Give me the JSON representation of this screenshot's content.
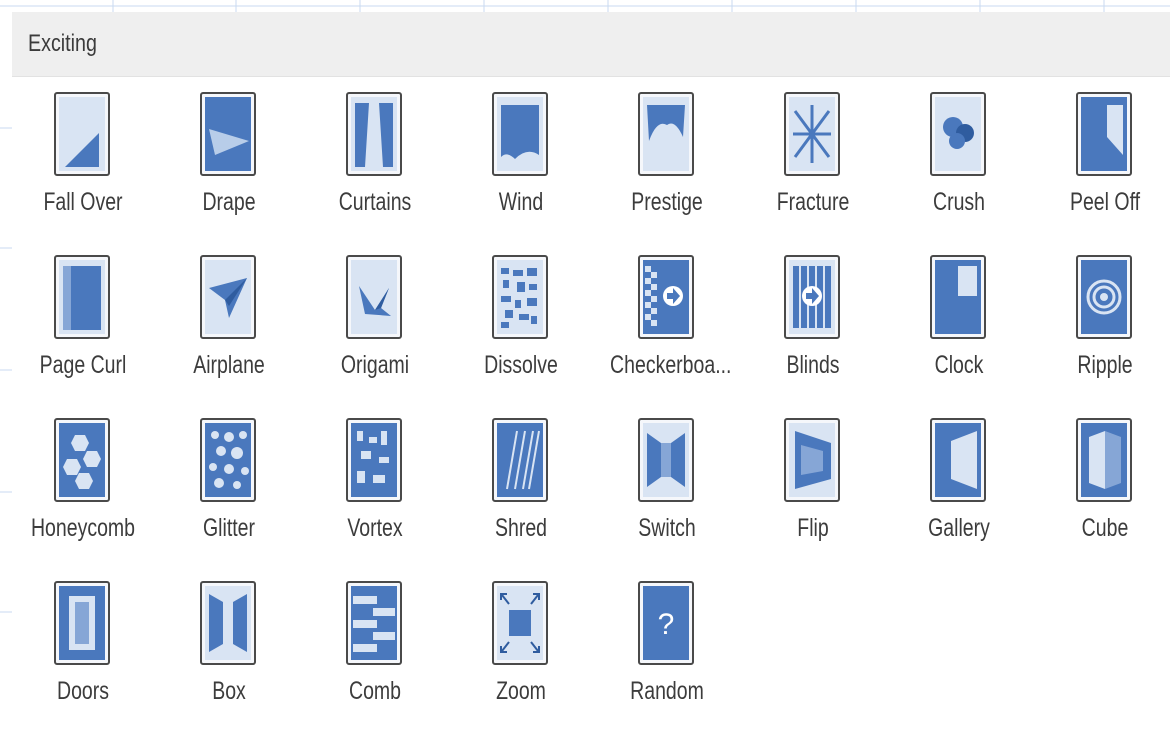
{
  "section": {
    "title": "Exciting"
  },
  "colors": {
    "accent": "#4a78bd",
    "light": "#d9e4f3",
    "header_bg": "#efefef",
    "text": "#3c3c3c"
  },
  "transitions": [
    {
      "label": "Fall Over",
      "icon": "fall-over-icon"
    },
    {
      "label": "Drape",
      "icon": "drape-icon"
    },
    {
      "label": "Curtains",
      "icon": "curtains-icon"
    },
    {
      "label": "Wind",
      "icon": "wind-icon"
    },
    {
      "label": "Prestige",
      "icon": "prestige-icon"
    },
    {
      "label": "Fracture",
      "icon": "fracture-icon"
    },
    {
      "label": "Crush",
      "icon": "crush-icon"
    },
    {
      "label": "Peel Off",
      "icon": "peel-off-icon"
    },
    {
      "label": "Page Curl",
      "icon": "page-curl-icon"
    },
    {
      "label": "Airplane",
      "icon": "airplane-icon"
    },
    {
      "label": "Origami",
      "icon": "origami-icon"
    },
    {
      "label": "Dissolve",
      "icon": "dissolve-icon"
    },
    {
      "label": "Checkerboa...",
      "icon": "checkerboard-icon"
    },
    {
      "label": "Blinds",
      "icon": "blinds-icon"
    },
    {
      "label": "Clock",
      "icon": "clock-icon"
    },
    {
      "label": "Ripple",
      "icon": "ripple-icon"
    },
    {
      "label": "Honeycomb",
      "icon": "honeycomb-icon"
    },
    {
      "label": "Glitter",
      "icon": "glitter-icon"
    },
    {
      "label": "Vortex",
      "icon": "vortex-icon"
    },
    {
      "label": "Shred",
      "icon": "shred-icon"
    },
    {
      "label": "Switch",
      "icon": "switch-icon"
    },
    {
      "label": "Flip",
      "icon": "flip-icon"
    },
    {
      "label": "Gallery",
      "icon": "gallery-icon"
    },
    {
      "label": "Cube",
      "icon": "cube-icon"
    },
    {
      "label": "Doors",
      "icon": "doors-icon"
    },
    {
      "label": "Box",
      "icon": "box-icon"
    },
    {
      "label": "Comb",
      "icon": "comb-icon"
    },
    {
      "label": "Zoom",
      "icon": "zoom-icon"
    },
    {
      "label": "Random",
      "icon": "random-icon"
    }
  ]
}
